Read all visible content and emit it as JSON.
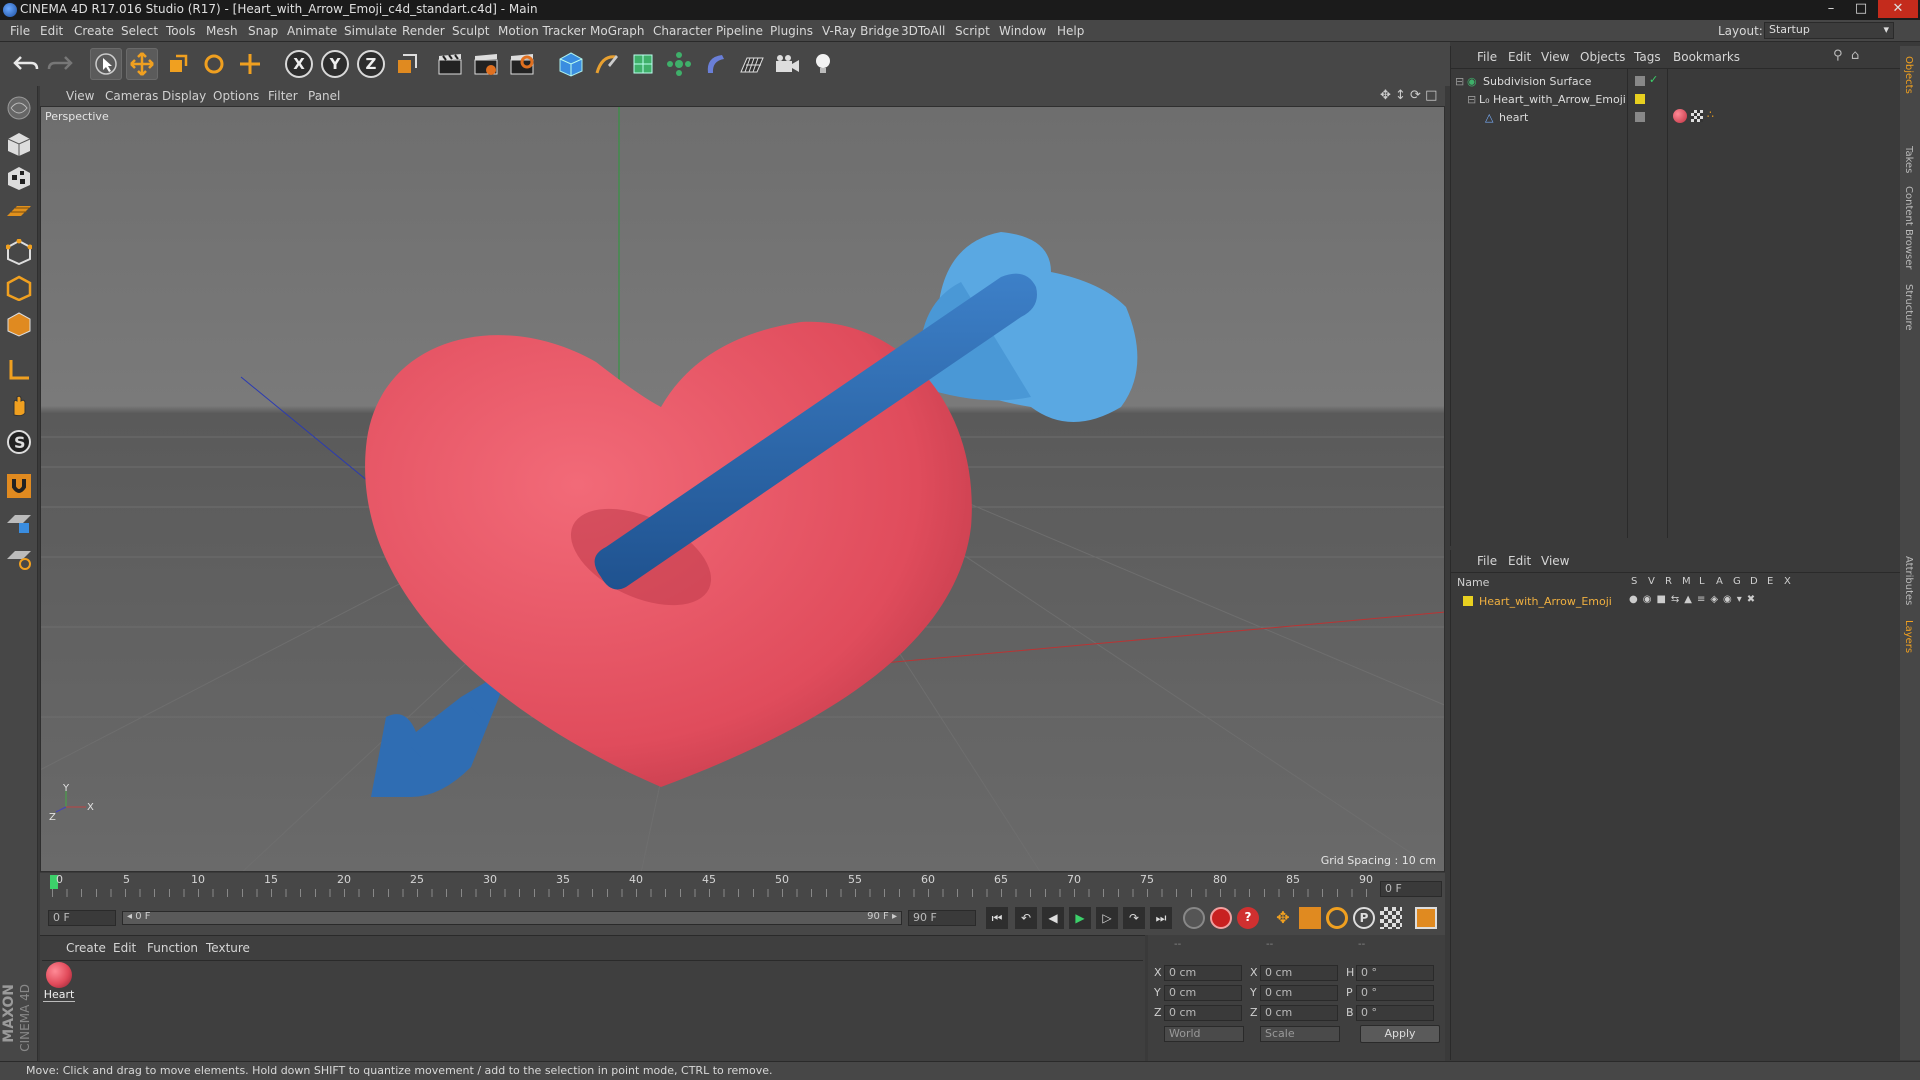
{
  "window": {
    "title": "CINEMA 4D R17.016 Studio (R17) - [Heart_with_Arrow_Emoji_c4d_standart.c4d] - Main",
    "controls": [
      "–",
      "□",
      "✕"
    ]
  },
  "menubar": {
    "items": [
      "File",
      "Edit",
      "Create",
      "Select",
      "Tools",
      "Mesh",
      "Snap",
      "Animate",
      "Simulate",
      "Render",
      "Sculpt",
      "Motion Tracker",
      "MoGraph",
      "Character",
      "Pipeline",
      "Plugins",
      "V-Ray Bridge",
      "3DToAll",
      "Script",
      "Window",
      "Help"
    ],
    "layout_label": "Layout:",
    "layout_value": "Startup"
  },
  "toolbar": {
    "axis_buttons": [
      "X",
      "Y",
      "Z"
    ]
  },
  "viewport": {
    "menu": [
      "View",
      "Cameras",
      "Display",
      "Options",
      "Filter",
      "Panel"
    ],
    "label": "Perspective",
    "grid_spacing": "Grid Spacing : 10 cm",
    "axis_y": "Y",
    "axis_z": "Z",
    "axis_x": "X"
  },
  "timeline": {
    "ticks": [
      "0",
      "5",
      "10",
      "15",
      "20",
      "25",
      "30",
      "35",
      "40",
      "45",
      "50",
      "55",
      "60",
      "65",
      "70",
      "75",
      "80",
      "85",
      "90"
    ],
    "current_frame": "0 F"
  },
  "transport": {
    "start_field": "0 F",
    "range_start": "◂ 0 F",
    "range_end": "90 F ▸",
    "end_field": "90 F"
  },
  "material_panel": {
    "menu": [
      "Create",
      "Edit",
      "Function",
      "Texture"
    ],
    "materials": [
      {
        "name": "Heart",
        "color": "#e14a5a"
      }
    ]
  },
  "coords_panel": {
    "header": [
      "--",
      "--",
      "--"
    ],
    "rows": [
      {
        "a": "X",
        "av": "0 cm",
        "b": "X",
        "bv": "0 cm",
        "c": "H",
        "cv": "0 °"
      },
      {
        "a": "Y",
        "av": "0 cm",
        "b": "Y",
        "bv": "0 cm",
        "c": "P",
        "cv": "0 °"
      },
      {
        "a": "Z",
        "av": "0 cm",
        "b": "Z",
        "bv": "0 cm",
        "c": "B",
        "cv": "0 °"
      }
    ],
    "mode1": "World",
    "mode2": "Scale",
    "apply": "Apply"
  },
  "objects_panel": {
    "menu": [
      "File",
      "Edit",
      "View",
      "Objects",
      "Tags",
      "Bookmarks"
    ],
    "items": [
      {
        "name": "Subdivision Surface",
        "depth": 0
      },
      {
        "name": "Heart_with_Arrow_Emoji",
        "depth": 1
      },
      {
        "name": "heart",
        "depth": 2
      }
    ]
  },
  "layers_panel": {
    "menu": [
      "File",
      "Edit",
      "View"
    ],
    "columns": [
      "Name",
      "S",
      "V",
      "R",
      "M",
      "L",
      "A",
      "G",
      "D",
      "E",
      "X"
    ],
    "items": [
      {
        "name": "Heart_with_Arrow_Emoji"
      }
    ]
  },
  "right_tabs": [
    "Objects",
    "Takes",
    "Content Browser",
    "Structure",
    "Attributes",
    "Layers"
  ],
  "brand": {
    "top": "MAXON",
    "bottom": "CINEMA 4D"
  },
  "status": "Move: Click and drag to move elements. Hold down SHIFT to quantize movement / add to the selection in point mode, CTRL to remove.",
  "colors": {
    "heart": "#e0505f",
    "arrow_shaft": "#2f6db3",
    "fletching": "#5aa8e2",
    "selection": "#f0b040"
  }
}
